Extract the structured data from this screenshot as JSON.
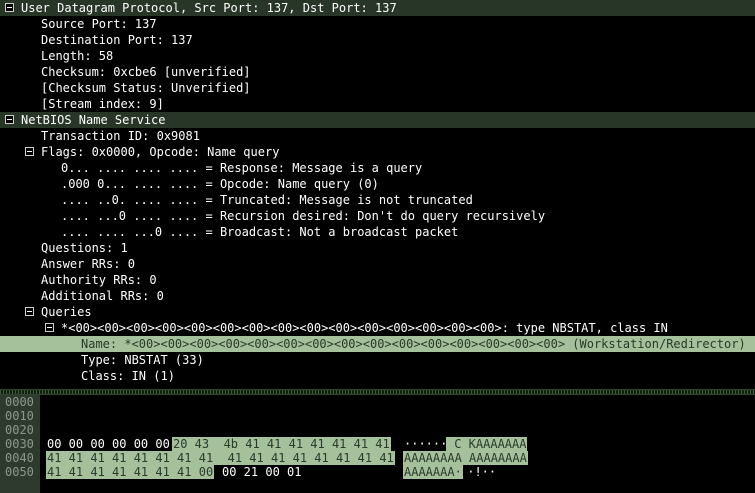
{
  "tree": {
    "udp_header": "User Datagram Protocol, Src Port: 137, Dst Port: 137",
    "udp_fields": [
      "Source Port: 137",
      "Destination Port: 137",
      "Length: 58",
      "Checksum: 0xcbe6 [unverified]",
      "[Checksum Status: Unverified]",
      "[Stream index: 9]"
    ],
    "nbns_header": "NetBIOS Name Service",
    "transaction_id": "Transaction ID: 0x9081",
    "flags": "Flags: 0x0000, Opcode: Name query",
    "flag_bits": [
      "0... .... .... .... = Response: Message is a query",
      ".000 0... .... .... = Opcode: Name query (0)",
      ".... ..0. .... .... = Truncated: Message is not truncated",
      ".... ...0 .... .... = Recursion desired: Don't do query recursively",
      ".... .... ...0 .... = Broadcast: Not a broadcast packet"
    ],
    "counts": [
      "Questions: 1",
      "Answer RRs: 0",
      "Authority RRs: 0",
      "Additional RRs: 0"
    ],
    "queries": "Queries",
    "query_entry": "*<00><00><00><00><00><00><00><00><00><00><00><00><00><00><00>: type NBSTAT, class IN",
    "query_name": "Name: *<00><00><00><00><00><00><00><00><00><00><00><00><00><00><00> (Workstation/Redirector)",
    "query_type": "Type: NBSTAT (33)",
    "query_class": "Class: IN (1)"
  },
  "bytes_pane": {
    "offsets": [
      "0000",
      "0010",
      "0020",
      "0030",
      "0040",
      "0050"
    ],
    "r30_hex_a": "00 00 00 00 00 00",
    "r30_hex_b": "20 43  4b 41 41 41 41 41 41 41",
    "r30_ascii_a": "······",
    "r30_ascii_b": " C KAAAAAAA",
    "r40_hex": "41 41 41 41 41 41 41 41  41 41 41 41 41 41 41 41",
    "r40_ascii": "AAAAAAAA AAAAAAAA",
    "r50_hex_a": "41 41 41 41 41 41 41 00",
    "r50_hex_b": "00 21 00 01",
    "r50_ascii_a": "AAAAAAA·",
    "r50_ascii_b": " ·!··"
  },
  "colors": {
    "background": "#000000",
    "section_header": "#283628",
    "selection": "#a5c19b",
    "offset_gutter": "#2e3a2e"
  }
}
